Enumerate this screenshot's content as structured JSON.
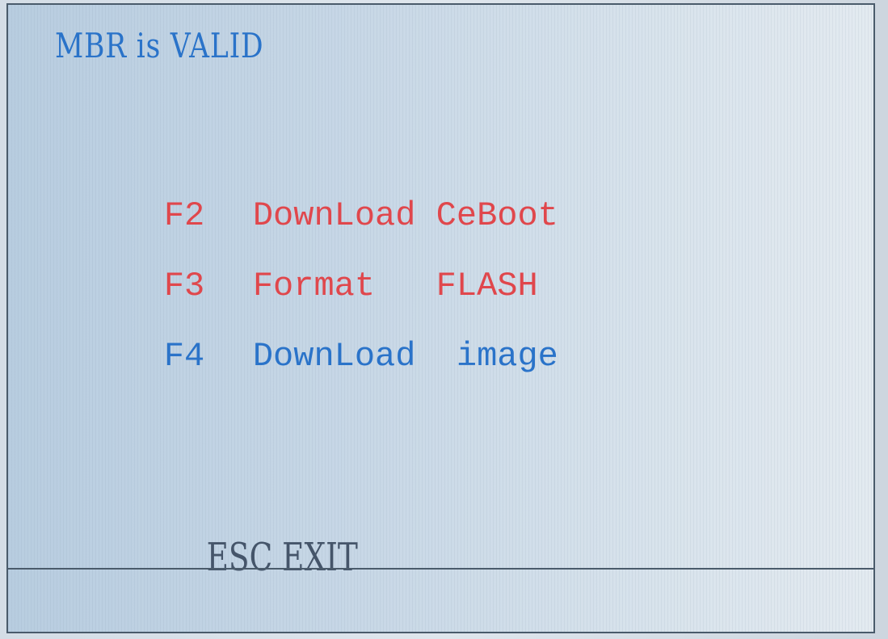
{
  "colors": {
    "red": "#e0474c",
    "blue": "#2a73c9",
    "dark": "#45556a"
  },
  "title": "MBR is VALID",
  "menu": [
    {
      "key": "F2",
      "label": "DownLoad CeBoot",
      "color": "red"
    },
    {
      "key": "F3",
      "label": "Format   FLASH",
      "color": "red"
    },
    {
      "key": "F4",
      "label": "DownLoad  image",
      "color": "blue"
    }
  ],
  "exit": {
    "key": "ESC",
    "label": "EXIT"
  }
}
